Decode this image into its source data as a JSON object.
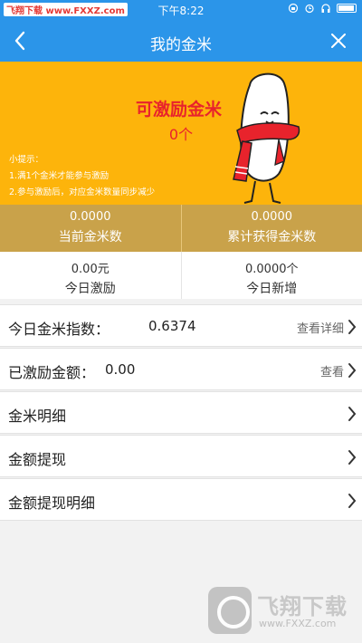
{
  "status_bar": {
    "watermark": "飞翔下载 www.FXXZ.com",
    "time": "下午8:22"
  },
  "nav": {
    "title": "我的金米",
    "back_glyph": "‹",
    "close_glyph": "✕"
  },
  "banner": {
    "headline": "可激励金米",
    "count": "0个",
    "tips_title": "小提示：",
    "tips": [
      "1.满1个金米才能参与激励",
      "2.参与激励后，对应金米数量同步减少"
    ]
  },
  "stats": [
    {
      "value": "0.0000",
      "label": "当前金米数"
    },
    {
      "value": "0.0000",
      "label": "累计获得金米数"
    }
  ],
  "today": [
    {
      "value": "0.00元",
      "label": "今日激励"
    },
    {
      "value": "0.0000个",
      "label": "今日新增"
    }
  ],
  "rows": [
    {
      "label": "今日金米指数：",
      "value": "0.6374",
      "action": "查看详细"
    },
    {
      "label": "已激励金额：",
      "value": "0.00",
      "action": "查看"
    },
    {
      "label": "金米明细"
    },
    {
      "label": "金额提现"
    },
    {
      "label": "金额提现明细"
    }
  ],
  "footer_watermark": {
    "cn": "飞翔下载",
    "en": "www.FXXZ.com"
  },
  "icons": {
    "back": "chevron-left-icon",
    "close": "close-icon",
    "row_chevron": "chevron-right-icon"
  },
  "colors": {
    "nav_blue": "#2b95e9",
    "banner_yellow": "#fdb40b",
    "stats_gold": "#c9a24a",
    "headline_red": "#e8232c"
  }
}
